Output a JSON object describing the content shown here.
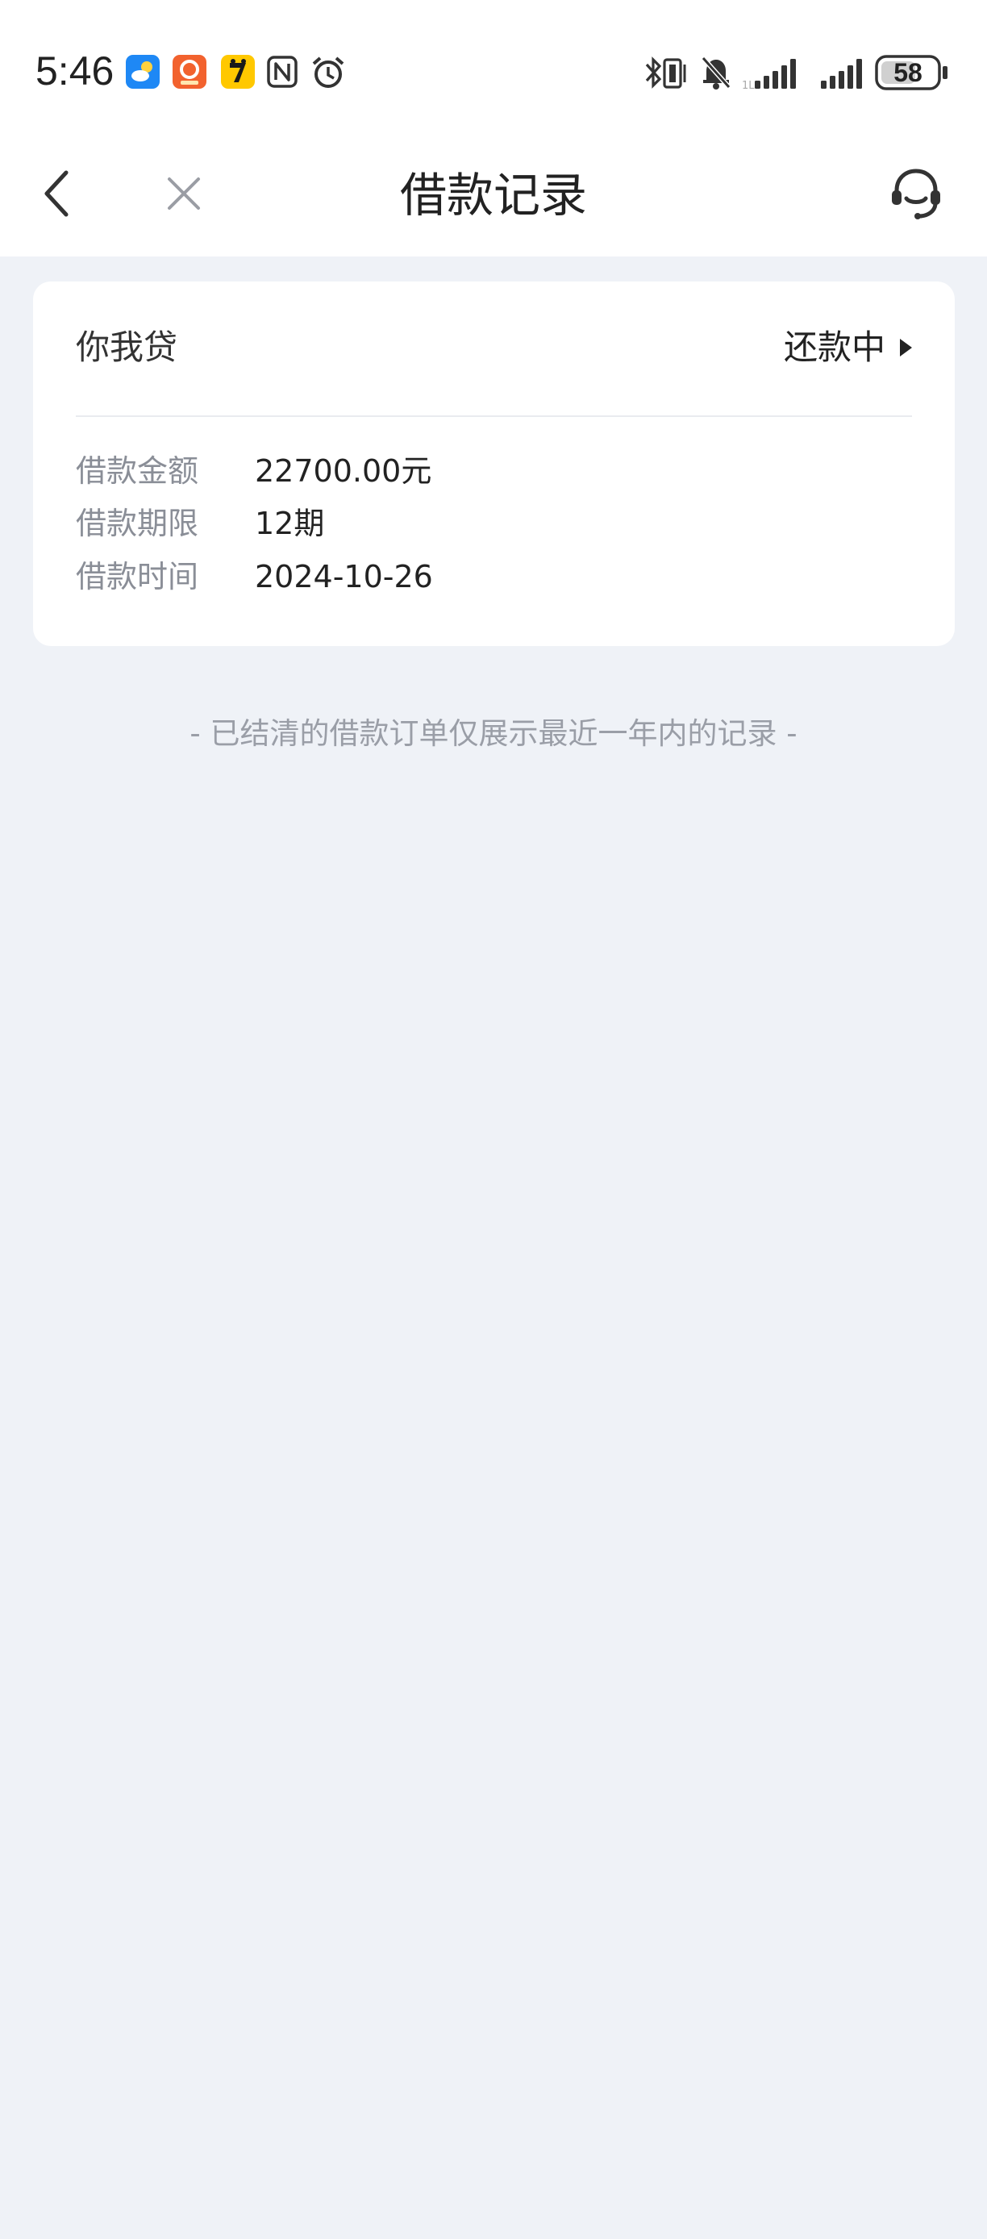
{
  "status_bar": {
    "time": "5:46",
    "battery": "58",
    "left_icons": [
      "weather-app-icon",
      "pinduoduo-app-icon",
      "qimao-app-icon",
      "nfc-icon",
      "alarm-icon"
    ],
    "right_icons": [
      "bluetooth-vibrate-icon",
      "muted-bell-icon",
      "signal-icon",
      "signal-icon",
      "battery-icon"
    ]
  },
  "nav": {
    "title": "借款记录",
    "back_icon": "chevron-left-icon",
    "close_icon": "close-icon",
    "service_icon": "headset-icon"
  },
  "loan_card": {
    "product_name": "你我贷",
    "status": "还款中",
    "rows": [
      {
        "label": "借款金额",
        "value": "22700.00元"
      },
      {
        "label": "借款期限",
        "value": "12期"
      },
      {
        "label": "借款时间",
        "value": "2024-10-26"
      }
    ]
  },
  "footer_note": "- 已结清的借款订单仅展示最近一年内的记录 -",
  "colors": {
    "page_background": "#eff2f7",
    "card_background": "#ffffff",
    "label_gray": "#8a8e97",
    "note_gray": "#9a9ea7",
    "text_dark": "#222222"
  }
}
